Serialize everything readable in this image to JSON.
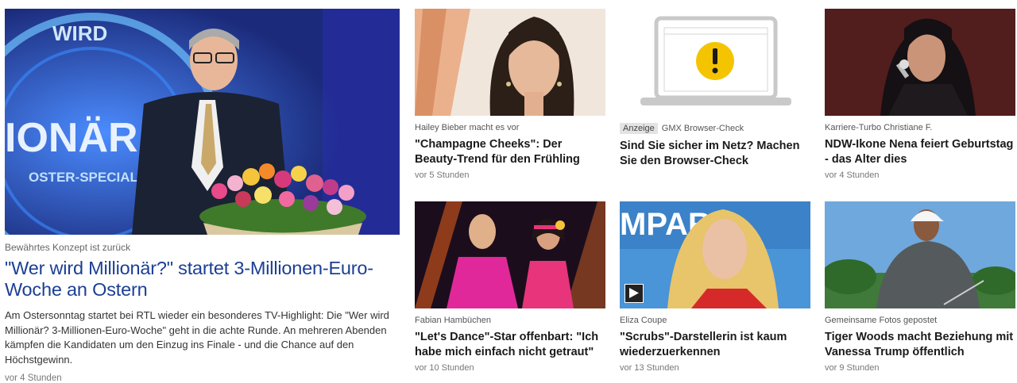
{
  "hero": {
    "image_alt": "Günther Jauch mit Blumenstrauß im Studio",
    "kicker": "Bewährtes Konzept ist zurück",
    "title": "\"Wer wird Millionär?\" startet 3-Millionen-Euro-Woche an Ostern",
    "teaser": "Am Ostersonntag startet bei RTL wieder ein besonderes TV-Highlight: Die \"Wer wird Millionär? 3-Millionen-Euro-Woche\" geht in die achte Runde. An mehreren Abenden kämpfen die Kandidaten um den Einzug ins Finale - und die Chance auf den Höchstgewinn.",
    "time": "vor 4 Stunden",
    "set_text_1": "WIRD",
    "set_text_2": "IONÄR",
    "set_text_3": "OSTER-SPECIAL"
  },
  "cards": [
    {
      "kicker": "Hailey Bieber macht es vor",
      "title": "\"Champagne Cheeks\": Der Beauty-Trend für den Frühling",
      "time": "vor 5 Stunden"
    },
    {
      "ad_label": "Anzeige",
      "kicker": "GMX Browser-Check",
      "title": "Sind Sie sicher im Netz? Machen Sie den Browser-Check",
      "time": ""
    },
    {
      "kicker": "Karriere-Turbo Christiane F.",
      "title": "NDW-Ikone Nena feiert Geburtstag - das Alter dies",
      "time": "vor 4 Stunden"
    },
    {
      "kicker": "Fabian Hambüchen",
      "title": "\"Let's Dance\"-Star offenbart: \"Ich habe mich einfach nicht getraut\"",
      "time": "vor 10 Stunden"
    },
    {
      "kicker": "Eliza Coupe",
      "title": "\"Scrubs\"-Darstellerin ist kaum wiederzuerkennen",
      "time": "vor 13 Stunden",
      "has_video": true,
      "bg_text": "MPARI"
    },
    {
      "kicker": "Gemeinsame Fotos gepostet",
      "title": "Tiger Woods macht Beziehung mit Vanessa Trump öffentlich",
      "time": "vor 9 Stunden"
    }
  ],
  "colors": {
    "hero_title": "#1c3f94",
    "warning_yellow": "#f5c400",
    "laptop_gray": "#c9c9c9"
  }
}
